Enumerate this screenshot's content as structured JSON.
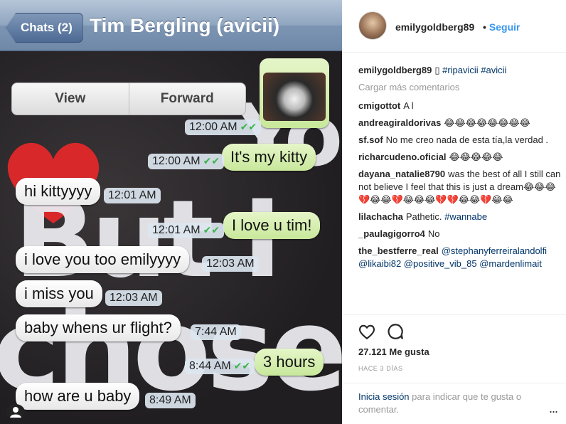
{
  "chat": {
    "back_label": "Chats (2)",
    "title": "Tim Bergling (avicii)",
    "menu": {
      "view": "View",
      "forward": "Forward"
    },
    "messages": [
      {
        "text": "",
        "time": "12:00 AM",
        "dir": "out"
      },
      {
        "text": "It's my kitty",
        "time": "12:00 AM",
        "dir": "out"
      },
      {
        "text": "hi kittyyyy",
        "time": "12:01 AM",
        "dir": "in"
      },
      {
        "text": "I love u tim!",
        "time": "12:01 AM",
        "dir": "out"
      },
      {
        "text": "i love you too emilyyyy",
        "time": "12:03 AM",
        "dir": "in"
      },
      {
        "text": "i miss you",
        "time": "12:03 AM",
        "dir": "in"
      },
      {
        "text": "baby whens ur flight?",
        "time": "7:44 AM",
        "dir": "in"
      },
      {
        "text": "3 hours",
        "time": "8:44 AM",
        "dir": "out"
      },
      {
        "text": "how are u baby",
        "time": "8:49 AM",
        "dir": "in"
      }
    ],
    "ticks": "✔✔"
  },
  "post": {
    "username": "emilygoldberg89",
    "follow_label": "Seguir",
    "separator": "•",
    "caption_user": "emilygoldberg89",
    "caption_text": "▯",
    "caption_tags": "#ripavicii #avicii",
    "load_more": "Cargar más comentarios",
    "comments": [
      {
        "user": "cmigottot",
        "text": "A l"
      },
      {
        "user": "andreagiraldorivas",
        "text": "😂😂😂😂😂😂😂😂"
      },
      {
        "user": "sf.sof",
        "text": "No me creo nada de esta tía,la verdad ."
      },
      {
        "user": "richarcudeno.oficial",
        "text": "😂😂😂😂😂"
      },
      {
        "user": "dayana_natalie8790",
        "text": "was the best of all I still can not believe I feel that this is just a dream😂😂😂💔😂😂💔😂😂😂💔💔😂😂💔😂😂"
      },
      {
        "user": "lilachacha",
        "text": "Pathetic.",
        "tag": "#wannabe"
      },
      {
        "user": "_paulagigorro4",
        "text": "No"
      },
      {
        "user": "the_bestferre_real",
        "text": "",
        "tag": "@stephanyferreiralandolfi @likaibi82 @positive_vib_85 @mardenlimait"
      }
    ],
    "likes": "27.121 Me gusta",
    "date": "HACE 3 DÍAS",
    "login_link": "Inicia sesión",
    "login_text": "para indicar que te gusta o comentar.",
    "more": "..."
  }
}
